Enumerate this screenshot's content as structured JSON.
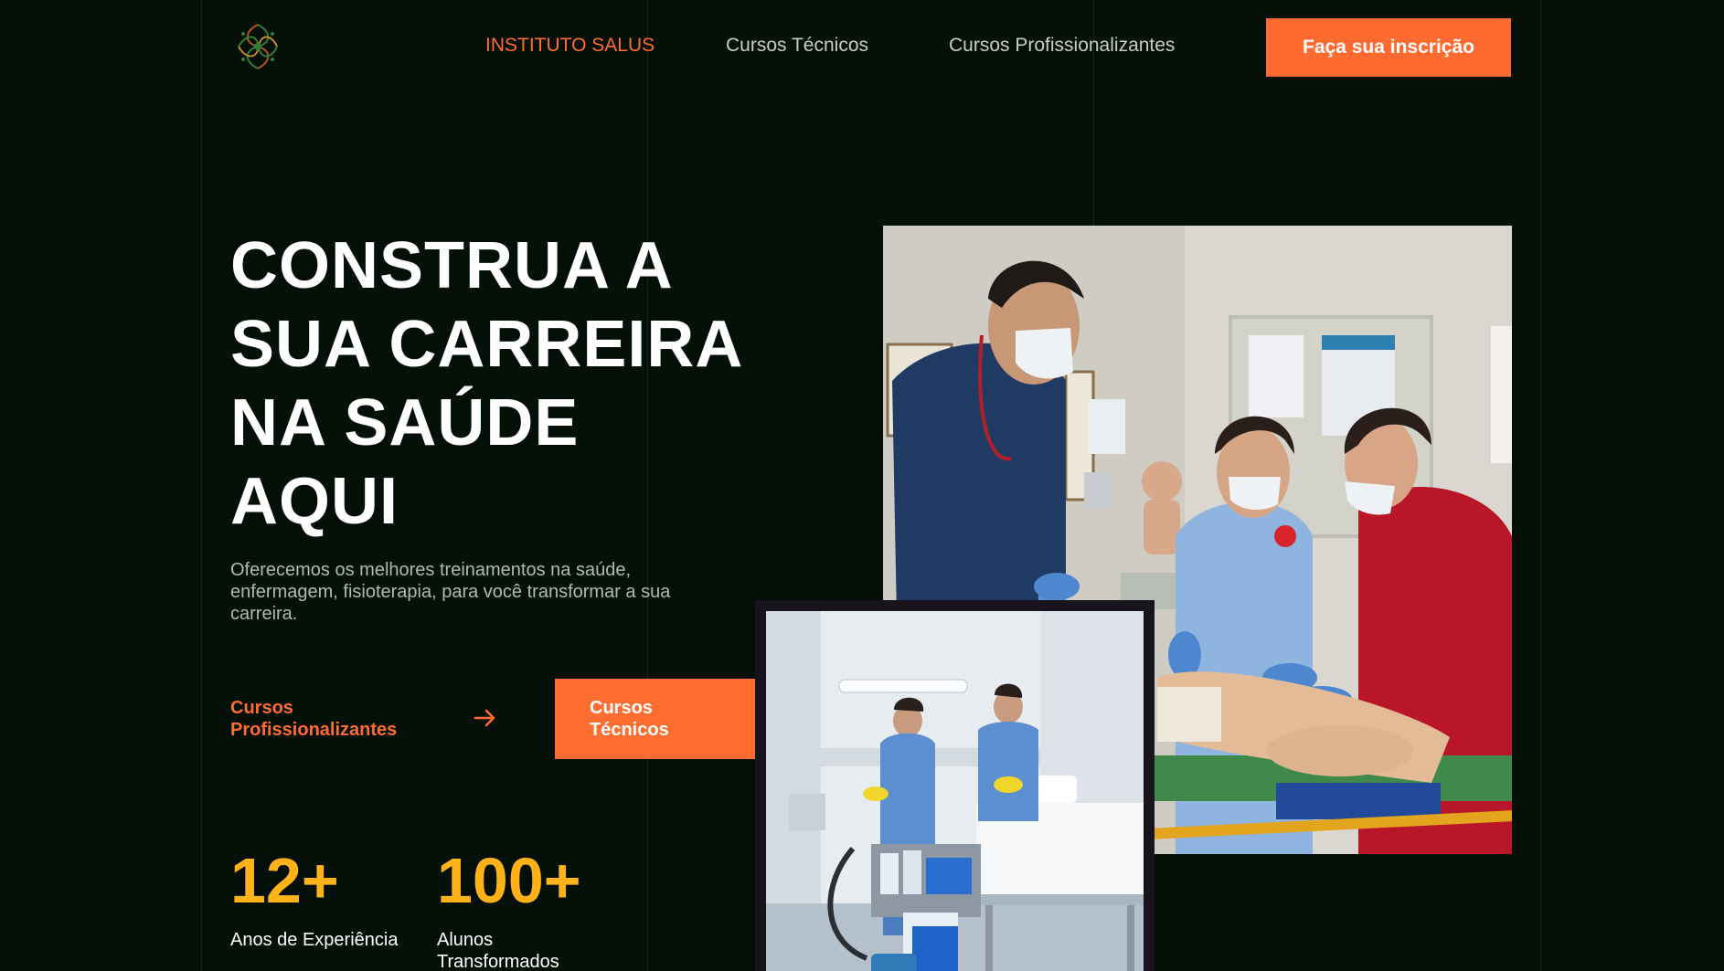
{
  "header": {
    "brand_label": "INSTITUTO SALUS",
    "nav": [
      "Cursos Técnicos",
      "Cursos Profissionalizantes"
    ],
    "cta_label": "Faça sua inscrição"
  },
  "hero": {
    "title_lines": [
      "CONSTRUA A",
      "SUA CARREIRA",
      "NA SAÚDE",
      "AQUI"
    ],
    "subtitle": "Oferecemos os melhores treinamentos na saúde, enfermagem, fisioterapia, para você transformar a sua carreira.",
    "link_prof_label": "Cursos Profissionalizantes",
    "btn_tec_label": "Cursos Técnicos"
  },
  "stats": [
    {
      "value": "12+",
      "label": "Anos de Experiência"
    },
    {
      "value": "100+",
      "label": "Alunos Transformados"
    }
  ],
  "colors": {
    "background": "#030f07",
    "accent": "#ff6a30",
    "stat": "#ffb319"
  },
  "icons": {
    "logo": "dna-leaf-logo-icon",
    "arrow": "arrow-right-icon"
  }
}
